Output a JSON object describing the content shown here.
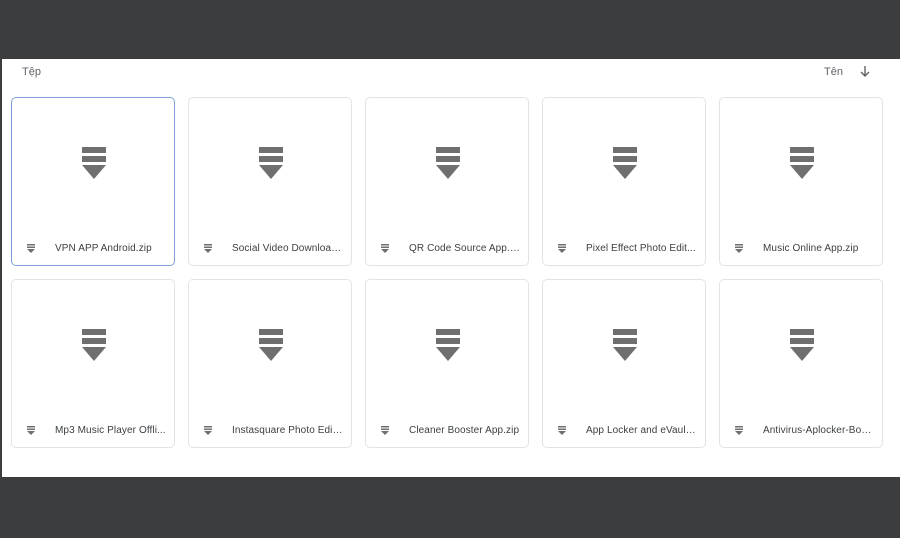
{
  "header": {
    "section_label": "Tệp",
    "sort_label": "Tên",
    "sort_icon": "arrow-down-icon"
  },
  "colors": {
    "background": "#3c3d3f",
    "panel": "#ffffff",
    "icon": "#6f6f6f",
    "selected_border": "#7ea2d8"
  },
  "files": [
    {
      "name": "VPN APP Android.zip",
      "icon": "zip-file-icon",
      "selected": true
    },
    {
      "name": "Social Video Download...",
      "icon": "zip-file-icon"
    },
    {
      "name": "QR Code Source App.zip",
      "icon": "zip-file-icon"
    },
    {
      "name": "Pixel Effect Photo Edit...",
      "icon": "zip-file-icon"
    },
    {
      "name": "Music Online App.zip",
      "icon": "zip-file-icon"
    },
    {
      "name": "Mp3 Music Player Offli...",
      "icon": "zip-file-icon"
    },
    {
      "name": "Instasquare Photo Edit...",
      "icon": "zip-file-icon"
    },
    {
      "name": "Cleaner Booster App.zip",
      "icon": "zip-file-icon"
    },
    {
      "name": "App Locker and eVault ...",
      "icon": "zip-file-icon"
    },
    {
      "name": "Antivirus-Aplocker-Boo...",
      "icon": "zip-file-icon"
    }
  ]
}
